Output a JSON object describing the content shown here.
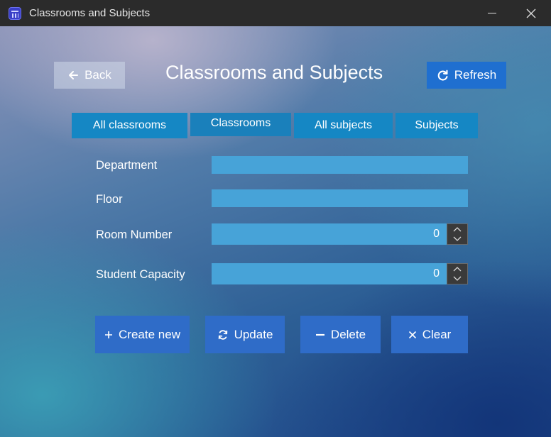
{
  "window": {
    "title": "Classrooms and Subjects",
    "icon": "calendar-icon"
  },
  "header": {
    "back_label": "Back",
    "title": "Classrooms and Subjects",
    "refresh_label": "Refresh"
  },
  "tabs": [
    {
      "label": "All classrooms",
      "active": false
    },
    {
      "label": "Classrooms",
      "active": true
    },
    {
      "label": "All subjects",
      "active": false
    },
    {
      "label": "Subjects",
      "active": false
    }
  ],
  "form": {
    "department": {
      "label": "Department",
      "value": ""
    },
    "floor": {
      "label": "Floor",
      "value": ""
    },
    "room_number": {
      "label": "Room Number",
      "value": "0"
    },
    "student_capacity": {
      "label": "Student Capacity",
      "value": "0"
    }
  },
  "actions": {
    "create_label": "Create new",
    "update_label": "Update",
    "delete_label": "Delete",
    "clear_label": "Clear"
  },
  "colors": {
    "accent": "#1f6fd0",
    "tab": "#1587c4",
    "field": "#47a3d8",
    "action": "#2f6cc8"
  }
}
